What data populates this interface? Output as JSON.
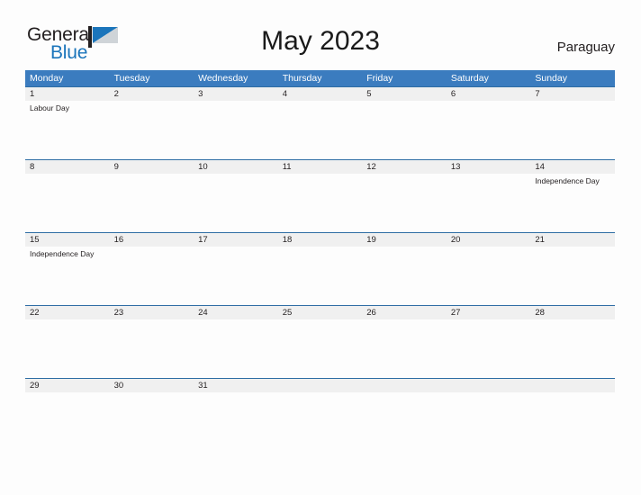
{
  "brand": {
    "name_part1": "General",
    "name_part2": "Blue",
    "flag_icon": "blue-flag-logo-icon",
    "accent_color": "#1b75bb"
  },
  "header": {
    "title": "May 2023",
    "region": "Paraguay"
  },
  "colors": {
    "header_blue": "#3b7cbf",
    "row_border_blue": "#2e6da4",
    "date_band_gray": "#f0f0f0",
    "text_dark": "#231f20"
  },
  "calendar": {
    "weekday_headers": [
      "Monday",
      "Tuesday",
      "Wednesday",
      "Thursday",
      "Friday",
      "Saturday",
      "Sunday"
    ],
    "weeks": [
      {
        "days": [
          {
            "number": "1",
            "events": [
              "Labour Day"
            ]
          },
          {
            "number": "2",
            "events": []
          },
          {
            "number": "3",
            "events": []
          },
          {
            "number": "4",
            "events": []
          },
          {
            "number": "5",
            "events": []
          },
          {
            "number": "6",
            "events": []
          },
          {
            "number": "7",
            "events": []
          }
        ]
      },
      {
        "days": [
          {
            "number": "8",
            "events": []
          },
          {
            "number": "9",
            "events": []
          },
          {
            "number": "10",
            "events": []
          },
          {
            "number": "11",
            "events": []
          },
          {
            "number": "12",
            "events": []
          },
          {
            "number": "13",
            "events": []
          },
          {
            "number": "14",
            "events": [
              "Independence Day"
            ]
          }
        ]
      },
      {
        "days": [
          {
            "number": "15",
            "events": [
              "Independence Day"
            ]
          },
          {
            "number": "16",
            "events": []
          },
          {
            "number": "17",
            "events": []
          },
          {
            "number": "18",
            "events": []
          },
          {
            "number": "19",
            "events": []
          },
          {
            "number": "20",
            "events": []
          },
          {
            "number": "21",
            "events": []
          }
        ]
      },
      {
        "days": [
          {
            "number": "22",
            "events": []
          },
          {
            "number": "23",
            "events": []
          },
          {
            "number": "24",
            "events": []
          },
          {
            "number": "25",
            "events": []
          },
          {
            "number": "26",
            "events": []
          },
          {
            "number": "27",
            "events": []
          },
          {
            "number": "28",
            "events": []
          }
        ]
      },
      {
        "days": [
          {
            "number": "29",
            "events": []
          },
          {
            "number": "30",
            "events": []
          },
          {
            "number": "31",
            "events": []
          },
          {
            "number": "",
            "events": []
          },
          {
            "number": "",
            "events": []
          },
          {
            "number": "",
            "events": []
          },
          {
            "number": "",
            "events": []
          }
        ]
      }
    ]
  }
}
